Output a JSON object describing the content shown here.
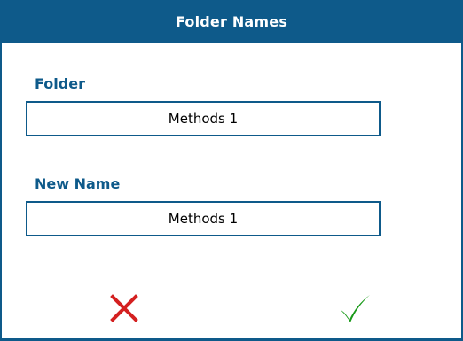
{
  "dialog": {
    "title": "Folder Names",
    "folder_label": "Folder",
    "folder_value": "Methods 1",
    "new_name_label": "New Name",
    "new_name_value": "Methods 1"
  },
  "actions": {
    "cancel_icon": "x-icon",
    "confirm_icon": "checkmark-icon"
  },
  "colors": {
    "accent": "#0e5a8a",
    "cancel": "#d42020",
    "confirm": "#1a9a1a"
  }
}
